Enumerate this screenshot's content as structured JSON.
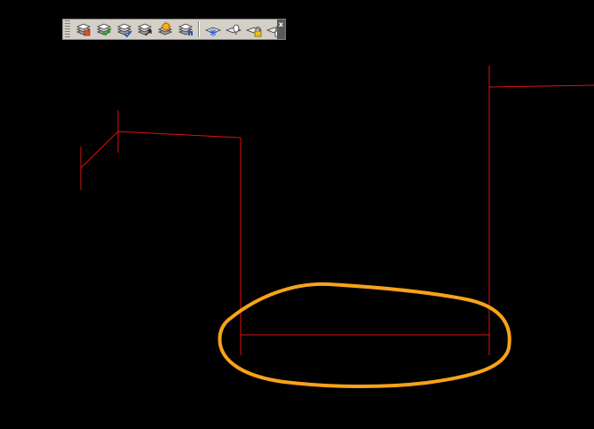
{
  "app": {
    "background_color": "#000000",
    "geometry_color": "#e01010",
    "highlight_color": "#f7a21b"
  },
  "toolbar": {
    "close_glyph": "x",
    "buttons": [
      {
        "icon": "layer-properties-icon"
      },
      {
        "icon": "layer-make-current-icon"
      },
      {
        "icon": "layer-match-icon"
      },
      {
        "icon": "layer-previous-icon"
      },
      {
        "icon": "layer-isolate-icon"
      },
      {
        "icon": "layer-walk-icon"
      },
      {
        "icon": "layer-freeze-icon"
      },
      {
        "icon": "layer-off-icon"
      },
      {
        "icon": "layer-lock-icon"
      },
      {
        "icon": "layer-unlock-icon"
      }
    ]
  }
}
